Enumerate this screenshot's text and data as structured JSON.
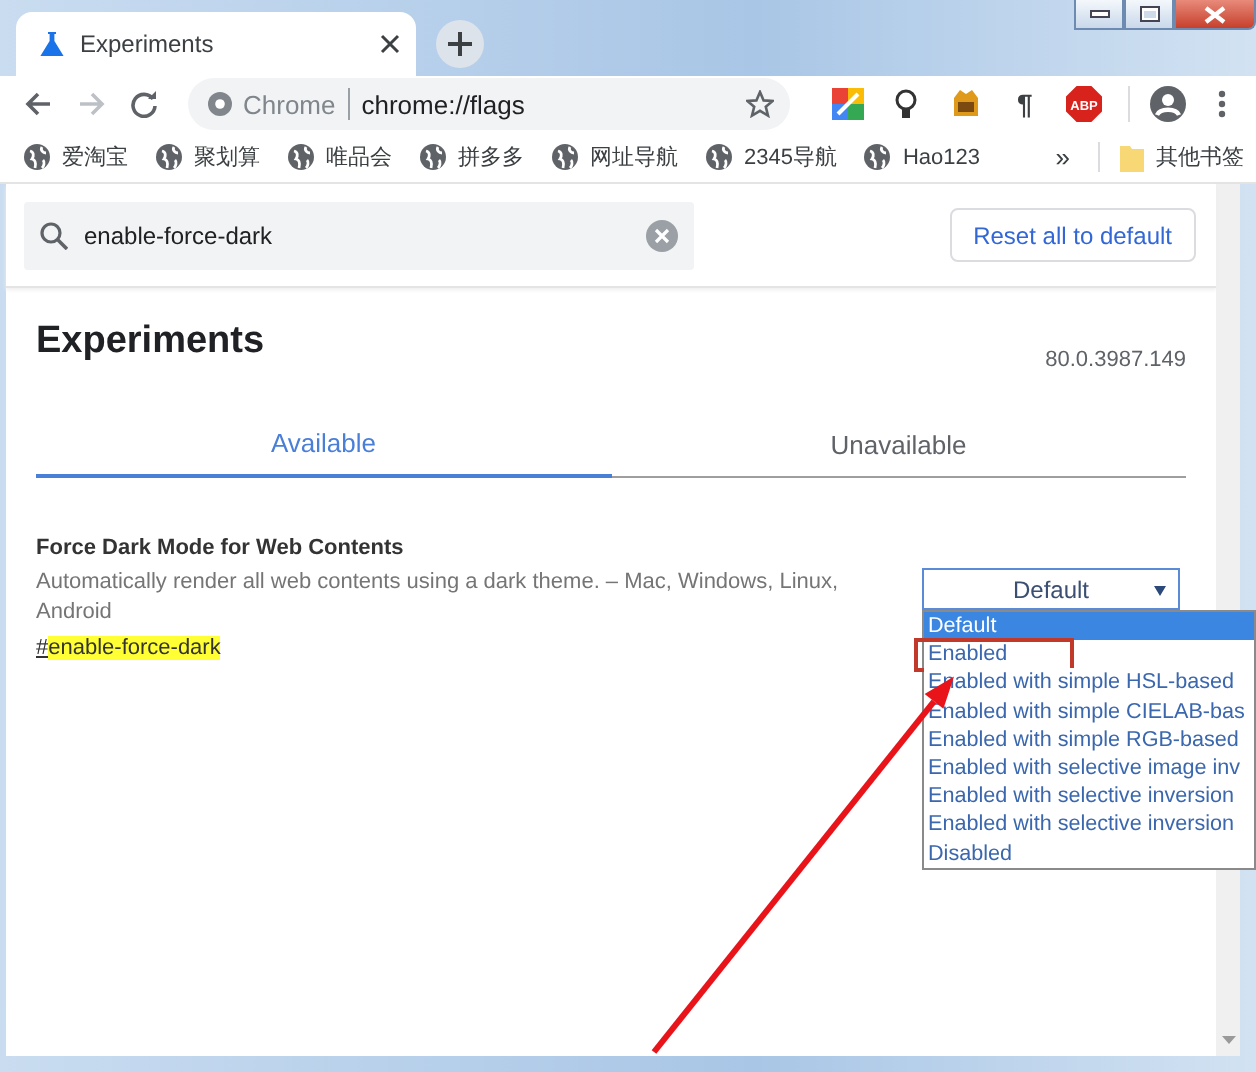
{
  "tabs": [
    {
      "title": "Experiments",
      "selected": true
    }
  ],
  "toolbar": {
    "omnibox": {
      "site": "Chrome",
      "url": "chrome://flags"
    },
    "extensions": [
      {
        "kind": "colors"
      },
      {
        "kind": "bulb"
      },
      {
        "kind": "lion"
      },
      {
        "kind": "pilcrow",
        "label": "¶"
      },
      {
        "kind": "abp",
        "label": "ABP"
      }
    ]
  },
  "bookmarks": {
    "items": [
      "爱淘宝",
      "聚划算",
      "唯品会",
      "拼多多",
      "网址导航",
      "2345导航",
      "Hao123"
    ],
    "overflow": "»",
    "folder": "其他书签"
  },
  "search": {
    "value": "enable-force-dark"
  },
  "reset_button": "Reset all to default",
  "title": "Experiments",
  "version": "80.0.3987.149",
  "page_tabs": [
    {
      "label": "Available",
      "selected": true
    },
    {
      "label": "Unavailable",
      "selected": false
    }
  ],
  "flag": {
    "name": "Force Dark Mode for Web Contents",
    "description": "Automatically render all web contents using a dark theme. – Mac, Windows, Linux, Android",
    "link": {
      "prefix": "#",
      "match": "enable-force-dark"
    },
    "select": {
      "value": "Default",
      "expanded": true,
      "options": [
        {
          "label": "Default",
          "selected": true,
          "highlighted": false
        },
        {
          "label": "Enabled",
          "selected": false,
          "highlighted": true
        },
        {
          "label": "Enabled with simple HSL-based",
          "selected": false,
          "highlighted": false
        },
        {
          "label": "Enabled with simple CIELAB-bas",
          "selected": false,
          "highlighted": false
        },
        {
          "label": "Enabled with simple RGB-based",
          "selected": false,
          "highlighted": false
        },
        {
          "label": "Enabled with selective image inv",
          "selected": false,
          "highlighted": false
        },
        {
          "label": "Enabled with selective inversion",
          "selected": false,
          "highlighted": false
        },
        {
          "label": "Enabled with selective inversion",
          "selected": false,
          "highlighted": false
        },
        {
          "label": "Disabled",
          "selected": false,
          "highlighted": false
        }
      ]
    }
  }
}
